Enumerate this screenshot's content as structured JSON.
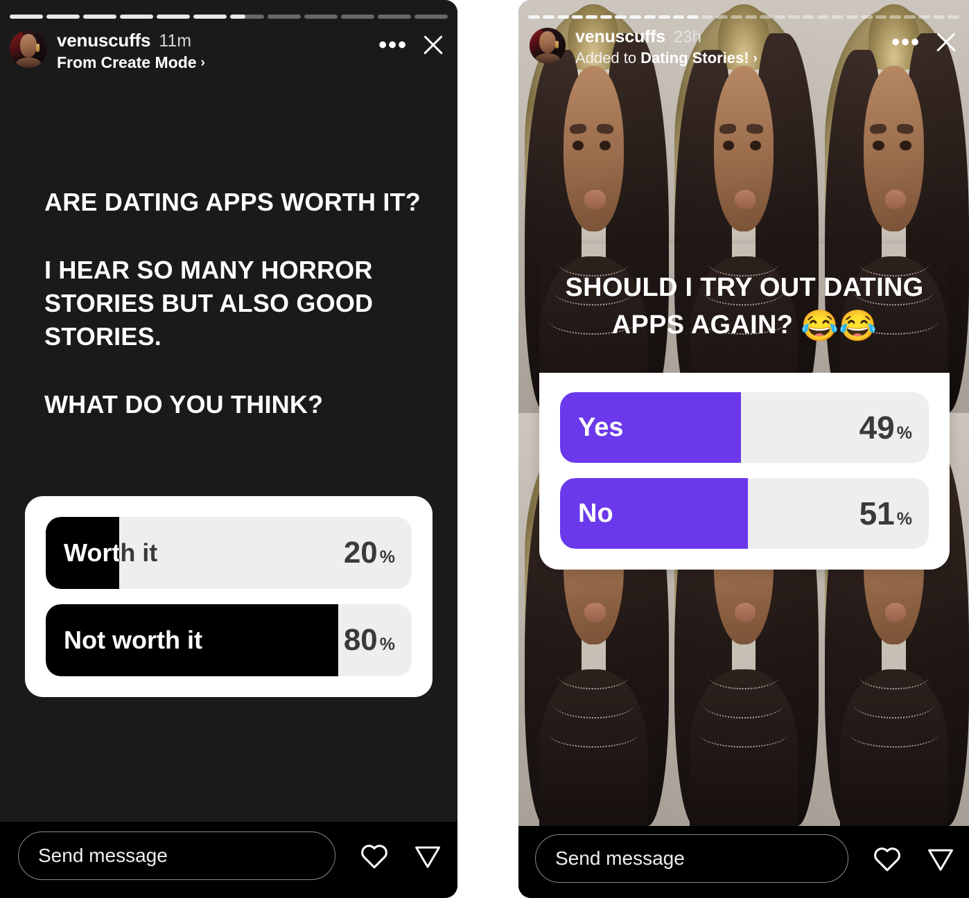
{
  "left_story": {
    "background_color": "#1a1a1a",
    "progress": {
      "total_segments": 12,
      "active_index": 6,
      "active_fill_pct": 45
    },
    "header": {
      "username": "venuscuffs",
      "timestamp": "11m",
      "context_prefix": "From ",
      "context_link": "Create Mode",
      "chevron": "›",
      "more_icon": "•••",
      "close_icon": "close-icon",
      "avatar": "profile-avatar"
    },
    "text_lines": [
      "ARE DATING APPS WORTH IT?",
      "I HEAR SO MANY HORROR STORIES BUT ALSO GOOD STORIES.",
      "WHAT DO YOU THINK?"
    ],
    "poll": {
      "accent_color": "#000000",
      "track_color": "#eeeeee",
      "card_color": "#ffffff",
      "options": [
        {
          "label": "Worth it",
          "percent": 20,
          "percent_text": "20",
          "symbol": "%"
        },
        {
          "label": "Not worth it",
          "percent": 80,
          "percent_text": "80",
          "symbol": "%"
        }
      ]
    },
    "footer": {
      "message_placeholder": "Send message",
      "like_icon": "heart-icon",
      "share_icon": "send-icon"
    }
  },
  "right_story": {
    "progress": {
      "total_segments": 30,
      "active_index": 11
    },
    "header": {
      "username": "venuscuffs",
      "timestamp": "23h",
      "context_prefix": "Added to ",
      "context_link": "Dating Stories!",
      "chevron": "›",
      "more_icon": "•••",
      "close_icon": "close-icon",
      "avatar": "profile-avatar"
    },
    "background": {
      "type": "photo-collage",
      "columns": 3,
      "rows": 2,
      "description": "repeated portrait selfie in front of ornate gold mirror"
    },
    "poll": {
      "question": "SHOULD I TRY OUT DATING APPS AGAIN? 😂😂",
      "question_line1": "SHOULD I TRY OUT DATING",
      "question_line2": "APPS AGAIN?",
      "emoji": "😂😂",
      "accent_color": "#6b38ec",
      "track_color": "#eeeeee",
      "card_color": "#ffffff",
      "options": [
        {
          "label": "Yes",
          "percent": 49,
          "percent_text": "49",
          "symbol": "%"
        },
        {
          "label": "No",
          "percent": 51,
          "percent_text": "51",
          "symbol": "%"
        }
      ]
    },
    "footer": {
      "message_placeholder": "Send message",
      "like_icon": "heart-icon",
      "share_icon": "send-icon"
    }
  },
  "chart_data": [
    {
      "type": "bar",
      "title": "ARE DATING APPS WORTH IT?",
      "orientation": "horizontal",
      "categories": [
        "Worth it",
        "Not worth it"
      ],
      "values": [
        20,
        80
      ],
      "unit": "%",
      "ylim": [
        0,
        100
      ],
      "grid": false,
      "legend": "none",
      "accent_color": "#000000"
    },
    {
      "type": "bar",
      "title": "SHOULD I TRY OUT DATING APPS AGAIN? 😂😂",
      "orientation": "horizontal",
      "categories": [
        "Yes",
        "No"
      ],
      "values": [
        49,
        51
      ],
      "unit": "%",
      "ylim": [
        0,
        100
      ],
      "grid": false,
      "legend": "none",
      "accent_color": "#6b38ec"
    }
  ]
}
